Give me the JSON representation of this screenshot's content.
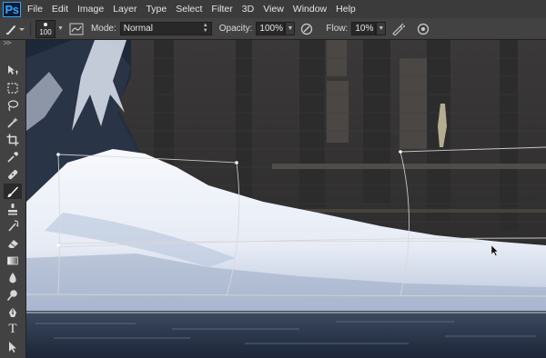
{
  "app": {
    "logo": "Ps"
  },
  "menu": [
    "File",
    "Edit",
    "Image",
    "Layer",
    "Type",
    "Select",
    "Filter",
    "3D",
    "View",
    "Window",
    "Help"
  ],
  "options": {
    "brush_size": "100",
    "mode_label": "Mode:",
    "mode_value": "Normal",
    "opacity_label": "Opacity:",
    "opacity_value": "100%",
    "flow_label": "Flow:",
    "flow_value": "10%"
  },
  "tools": [
    {
      "name": "move-tool",
      "icon": "move-icon"
    },
    {
      "name": "marquee-tool",
      "icon": "marquee-icon"
    },
    {
      "name": "lasso-tool",
      "icon": "lasso-icon"
    },
    {
      "name": "quick-selection-tool",
      "icon": "wand-icon"
    },
    {
      "name": "crop-tool",
      "icon": "crop-icon"
    },
    {
      "name": "eyedropper-tool",
      "icon": "eyedropper-icon"
    },
    {
      "name": "healing-brush-tool",
      "icon": "bandage-icon"
    },
    {
      "name": "brush-tool",
      "icon": "brush-icon",
      "active": true
    },
    {
      "name": "clone-stamp-tool",
      "icon": "stamp-icon"
    },
    {
      "name": "history-brush-tool",
      "icon": "history-brush-icon"
    },
    {
      "name": "eraser-tool",
      "icon": "eraser-icon"
    },
    {
      "name": "gradient-tool",
      "icon": "gradient-icon"
    },
    {
      "name": "blur-tool",
      "icon": "drop-icon"
    },
    {
      "name": "dodge-tool",
      "icon": "dodge-icon"
    },
    {
      "name": "pen-tool",
      "icon": "pen-icon"
    },
    {
      "name": "type-tool",
      "icon": "type-icon",
      "glyph": "T"
    }
  ],
  "colors": {
    "menubar": "#3b3b3b",
    "panel": "#424242",
    "accent": "#31a8ff"
  }
}
